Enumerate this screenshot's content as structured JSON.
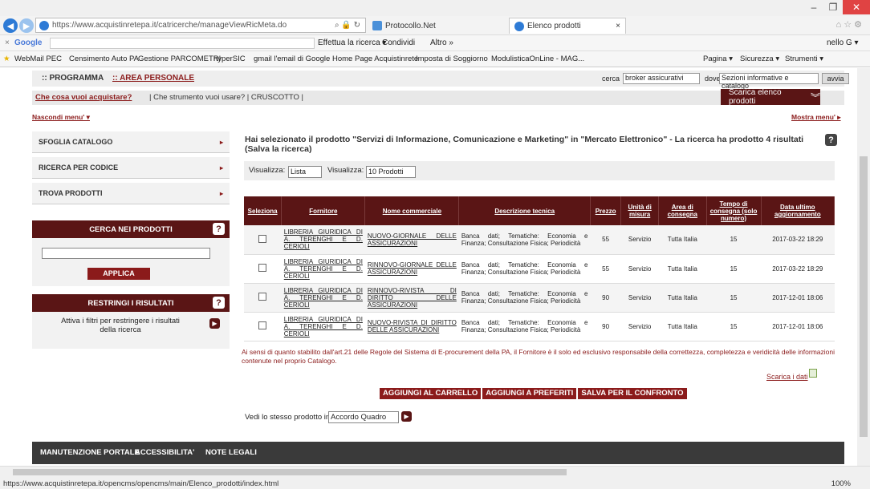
{
  "browser": {
    "url": "https://www.acquistinretepa.it/catricerche/manageViewRicMeta.do",
    "url_host": "www.acquistinretepa.it",
    "tabs": [
      "Protocollo.Net",
      "Elenco prodotti"
    ],
    "google_label": "Google",
    "google_items": [
      "Effettua la ricerca ▾",
      "Condividi",
      "Altro »",
      "nello G ▾"
    ],
    "favorites": [
      "WebMail PEC",
      "Censimento Auto PA",
      "Gestione PARCOMETRI",
      "hyperSIC",
      "gmail l'email di Google",
      "Home Page Acquistinrete",
      "Imposta di Soggiorno",
      "ModulisticaOnLine - MAG..."
    ],
    "fav_tools": [
      "Pagina ▾",
      "Sicurezza ▾",
      "Strumenti ▾"
    ],
    "status_url": "https://www.acquistinretepa.it/opencms/opencms/main/Elenco_prodotti/index.html",
    "zoom": "100%"
  },
  "topnav": {
    "programma": ":: PROGRAMMA",
    "area": ":: AREA PERSONALE",
    "cerca_label": "cerca",
    "cerca_value": "broker assicurativi",
    "dove_label": "dove",
    "dove_value": "Sezioni informative e catalogo",
    "avvia": "avvia"
  },
  "subnav": {
    "first": "Che cosa vuoi acquistare?",
    "rest": "|  Che strumento vuoi usare?  |  CRUSCOTTO  |",
    "scarica": "Scarica elenco prodotti"
  },
  "nascondi": "Nascondi menu' ▾",
  "mostra": "Mostra menu' ▸",
  "menu": [
    "SFOGLIA CATALOGO",
    "RICERCA PER CODICE",
    "TROVA PRODOTTI"
  ],
  "cerca_box": {
    "title": "CERCA NEI PRODOTTI",
    "button": "APPLICA"
  },
  "restringi_box": {
    "title": "RESTRINGI I RISULTATI",
    "text": "Attiva i filtri per restringere i risultati della ricerca"
  },
  "headline": "Hai selezionato il prodotto \"Servizi di Informazione, Comunicazione e Marketing\" in \"Mercato Elettronico\" - La ricerca ha prodotto 4 risultati (Salva la ricerca)",
  "visualizza": {
    "label1": "Visualizza:",
    "value1": "Lista",
    "label2": "Visualizza:",
    "value2": "10 Prodotti"
  },
  "table": {
    "headers": [
      "Seleziona",
      "Fornitore",
      "Nome commerciale",
      "Descrizione tecnica",
      "Prezzo",
      "Unità di misura",
      "Area di consegna",
      "Tempo di consegna (solo numero)",
      "Data ultimo aggiornamento"
    ],
    "rows": [
      {
        "fornitore": "LIBRERIA GIURIDICA DI A. TERENGHI E D. CERIOLI",
        "nome": "NUOVO-GIORNALE DELLE ASSICURAZIONI",
        "desc": "Banca dati; Tematiche: Economia e Finanza; Consultazione Fisica; Periodicità",
        "prezzo": "55",
        "unita": "Servizio",
        "area": "Tutta Italia",
        "tempo": "15",
        "data": "2017-03-22 18:29"
      },
      {
        "fornitore": "LIBRERIA GIURIDICA DI A. TERENGHI E D. CERIOLI",
        "nome": "RINNOVO-GIORNALE DELLE ASSICURAZIONI",
        "desc": "Banca dati; Tematiche: Economia e Finanza; Consultazione Fisica; Periodicità",
        "prezzo": "55",
        "unita": "Servizio",
        "area": "Tutta Italia",
        "tempo": "15",
        "data": "2017-03-22 18:29"
      },
      {
        "fornitore": "LIBRERIA GIURIDICA DI A. TERENGHI E D. CERIOLI",
        "nome": "RINNOVO-RIVISTA DI DIRITTO DELLE ASSICURAZIONI",
        "desc": "Banca dati; Tematiche: Economia e Finanza; Consultazione Fisica; Periodicità",
        "prezzo": "90",
        "unita": "Servizio",
        "area": "Tutta Italia",
        "tempo": "15",
        "data": "2017-12-01 18:06"
      },
      {
        "fornitore": "LIBRERIA GIURIDICA DI A. TERENGHI E D. CERIOLI",
        "nome": "NUOVO-RIVISTA DI DIRITTO DELLE ASSICURAZIONI",
        "desc": "Banca dati; Tematiche: Economia e Finanza; Consultazione Fisica; Periodicità",
        "prezzo": "90",
        "unita": "Servizio",
        "area": "Tutta Italia",
        "tempo": "15",
        "data": "2017-12-01 18:06"
      }
    ]
  },
  "note": "Ai sensi di quanto stabilito dall'art.21 delle Regole del Sistema di E-procurement della PA, il Fornitore è il solo ed esclusivo responsabile della correttezza, completezza e veridicità delle informazioni contenute nel proprio Catalogo.",
  "scarica_dati": "Scarica i dati",
  "actions": [
    "AGGIUNGI AL CARRELLO",
    "AGGIUNGI A PREFERITI",
    "SALVA PER IL CONFRONTO"
  ],
  "vedi": {
    "label": "Vedi lo stesso prodotto in",
    "value": "Accordo Quadro"
  },
  "footer": [
    "MANUTENZIONE PORTALE",
    "ACCESSIBILITA'",
    "NOTE LEGALI"
  ],
  "colors": {
    "brand": "#5a1515",
    "accent": "#8b1b1b"
  }
}
